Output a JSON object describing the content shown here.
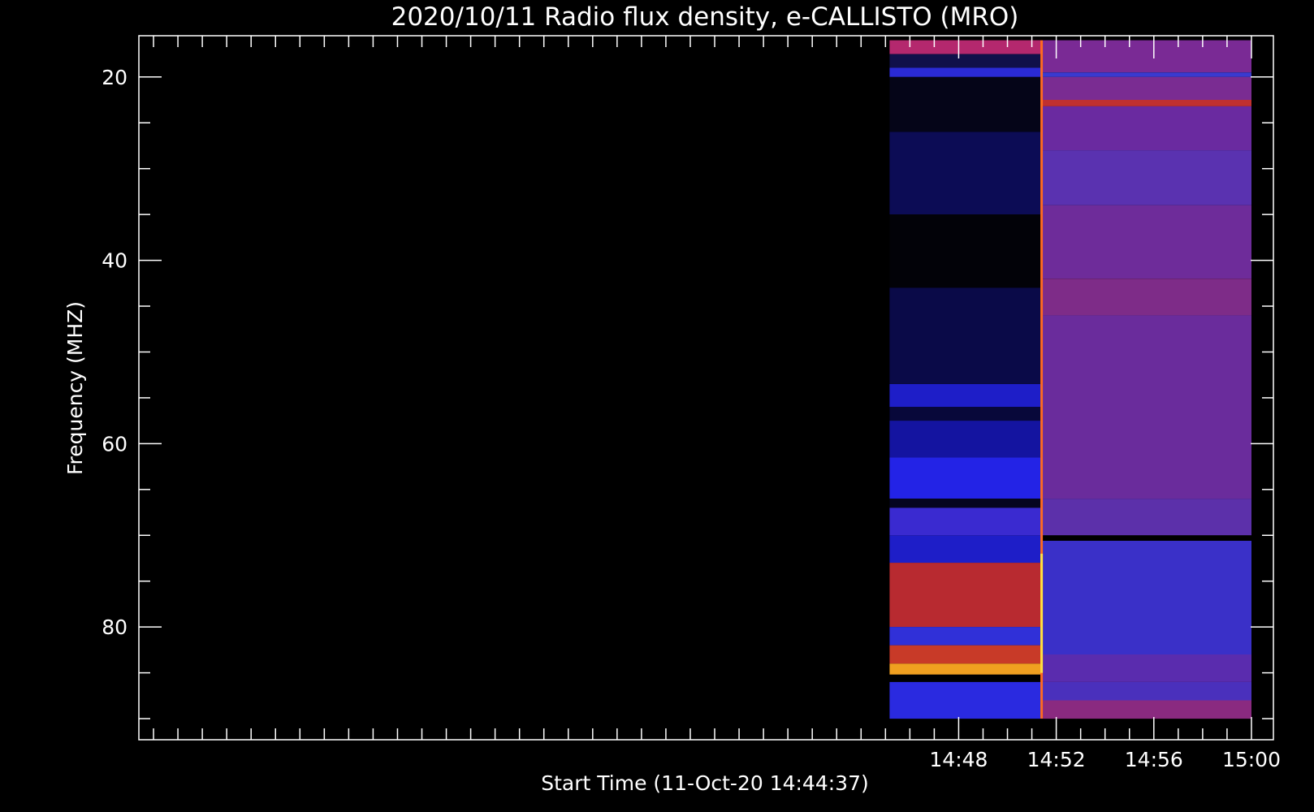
{
  "chart_data": {
    "type": "heatmap",
    "title": "2020/10/11  Radio flux density, e-CALLISTO (MRO)",
    "xlabel": "Start Time (11-Oct-20 14:44:37)",
    "ylabel": "Frequency (MHZ)",
    "x_axis": {
      "range_minutes": [
        14.4,
        60.9
      ],
      "ticks": [
        {
          "minute": 48,
          "label": "14:48"
        },
        {
          "minute": 52,
          "label": "14:52"
        },
        {
          "minute": 56,
          "label": "14:56"
        },
        {
          "minute": 60,
          "label": "15:00"
        }
      ],
      "minor_tick_step": 1
    },
    "y_axis": {
      "range": [
        15.5,
        92.3
      ],
      "inverted": true,
      "ticks": [
        20,
        40,
        60,
        80
      ],
      "minor_tick_step": 5
    },
    "data_extent": {
      "minute_start": 45.17,
      "minute_end": 60.0,
      "freq_min": 16.0,
      "freq_max": 90.0
    },
    "segments": [
      {
        "name": "early",
        "minute_start": 45.17,
        "minute_end": 51.4,
        "bands": [
          {
            "from": 16.0,
            "to": 17.5,
            "color": "#b4286e"
          },
          {
            "from": 17.5,
            "to": 19.0,
            "color": "#10104a"
          },
          {
            "from": 19.0,
            "to": 20.0,
            "color": "#2a2ad6"
          },
          {
            "from": 20.0,
            "to": 26.0,
            "color": "#050518"
          },
          {
            "from": 26.0,
            "to": 35.0,
            "color": "#0c0c55"
          },
          {
            "from": 35.0,
            "to": 43.0,
            "color": "#020208"
          },
          {
            "from": 43.0,
            "to": 53.5,
            "color": "#0a0a48"
          },
          {
            "from": 53.5,
            "to": 56.0,
            "color": "#1e1ec8"
          },
          {
            "from": 56.0,
            "to": 57.5,
            "color": "#08083a"
          },
          {
            "from": 57.5,
            "to": 61.5,
            "color": "#1414a0"
          },
          {
            "from": 61.5,
            "to": 66.0,
            "color": "#2323e6"
          },
          {
            "from": 66.0,
            "to": 67.0,
            "color": "#050520"
          },
          {
            "from": 67.0,
            "to": 70.0,
            "color": "#3a2ad0"
          },
          {
            "from": 70.0,
            "to": 73.0,
            "color": "#1e1ec8"
          },
          {
            "from": 73.0,
            "to": 80.0,
            "color": "#b82a30"
          },
          {
            "from": 80.0,
            "to": 82.0,
            "color": "#3030d8"
          },
          {
            "from": 82.0,
            "to": 84.0,
            "color": "#c83a28"
          },
          {
            "from": 84.0,
            "to": 85.2,
            "color": "#f0a020"
          },
          {
            "from": 85.2,
            "to": 86.0,
            "color": "#000000"
          },
          {
            "from": 86.0,
            "to": 90.0,
            "color": "#2a2ae0"
          }
        ]
      },
      {
        "name": "late",
        "minute_start": 51.4,
        "minute_end": 60.0,
        "bands": [
          {
            "from": 16.0,
            "to": 19.5,
            "color": "#7a2a95"
          },
          {
            "from": 19.5,
            "to": 20.0,
            "color": "#3a3ad0"
          },
          {
            "from": 20.0,
            "to": 22.5,
            "color": "#7a2c92"
          },
          {
            "from": 22.5,
            "to": 23.2,
            "color": "#c03030"
          },
          {
            "from": 23.2,
            "to": 28.0,
            "color": "#6a2aa0"
          },
          {
            "from": 28.0,
            "to": 34.0,
            "color": "#5a32b0"
          },
          {
            "from": 34.0,
            "to": 42.0,
            "color": "#6e2c9a"
          },
          {
            "from": 42.0,
            "to": 46.0,
            "color": "#7e2c88"
          },
          {
            "from": 46.0,
            "to": 66.0,
            "color": "#6a2c9c"
          },
          {
            "from": 66.0,
            "to": 70.0,
            "color": "#5c30aa"
          },
          {
            "from": 70.0,
            "to": 70.6,
            "color": "#000000"
          },
          {
            "from": 70.6,
            "to": 83.0,
            "color": "#3a30c8"
          },
          {
            "from": 83.0,
            "to": 86.0,
            "color": "#5a2cae"
          },
          {
            "from": 86.0,
            "to": 88.0,
            "color": "#4a30bc"
          },
          {
            "from": 88.0,
            "to": 90.0,
            "color": "#8a2a80"
          }
        ]
      }
    ],
    "transition_minute": 51.4,
    "colors": {
      "background": "#000000",
      "axes": "#ffffff",
      "transition_line": "#ff6a20",
      "transition_hot": "#ffe040"
    }
  }
}
